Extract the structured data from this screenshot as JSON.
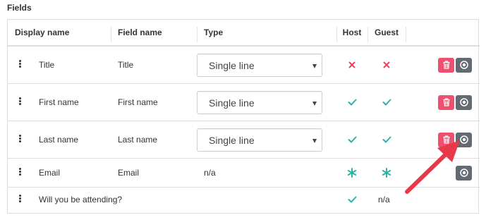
{
  "section_title": "Fields",
  "columns": {
    "display_name": "Display name",
    "field_name": "Field name",
    "type": "Type",
    "host": "Host",
    "guest": "Guest"
  },
  "rows": [
    {
      "display_name": "Title",
      "field_name": "Title",
      "type": "Single line",
      "host": "cross-icon",
      "guest": "cross-icon",
      "actions": [
        "delete-button",
        "view-button"
      ]
    },
    {
      "display_name": "First name",
      "field_name": "First name",
      "type": "Single line",
      "host": "check-icon",
      "guest": "check-icon",
      "actions": [
        "delete-button",
        "view-button"
      ]
    },
    {
      "display_name": "Last name",
      "field_name": "Last name",
      "type": "Single line",
      "host": "check-icon",
      "guest": "check-icon",
      "actions": [
        "delete-button",
        "view-button"
      ]
    },
    {
      "display_name": "Email",
      "field_name": "Email",
      "type": "n/a",
      "host": "asterisk-icon",
      "guest": "asterisk-icon",
      "actions": [
        "view-button"
      ]
    },
    {
      "display_name": "Will you be attending?",
      "field_name": "",
      "type": "",
      "host": "check-icon",
      "guest": "n/a",
      "actions": []
    }
  ],
  "colors": {
    "check": "#2ab3a3",
    "cross": "#e8455c",
    "delete_button": "#f05070",
    "view_button": "#636a72",
    "annotation_arrow": "#e8394a"
  }
}
